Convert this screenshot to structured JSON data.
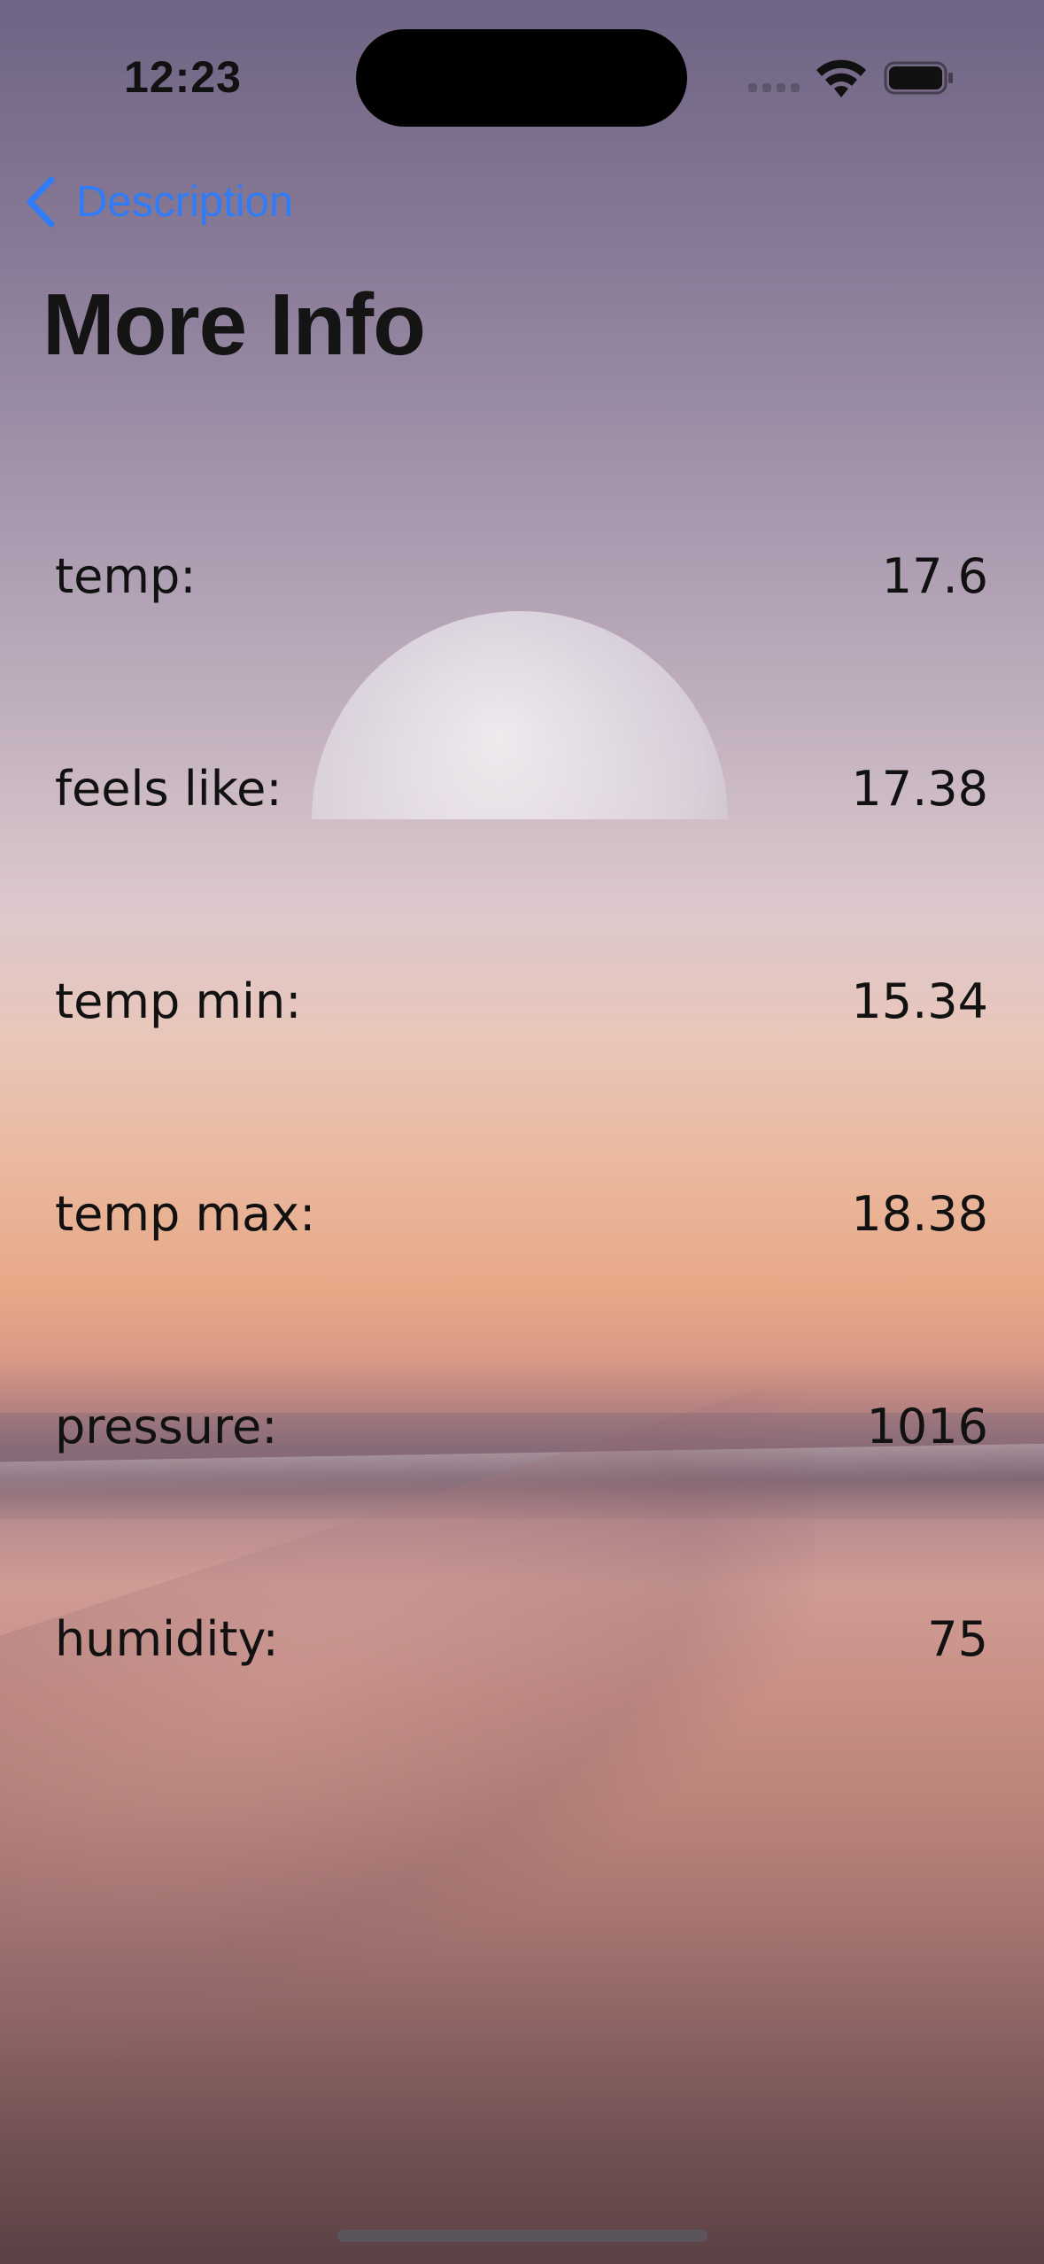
{
  "status_bar": {
    "time": "12:23"
  },
  "nav": {
    "back_label": "Description",
    "title": "More Info"
  },
  "info_rows": [
    {
      "label": "temp:",
      "value": "17.6"
    },
    {
      "label": "feels like:",
      "value": "17.38"
    },
    {
      "label": "temp min:",
      "value": "15.34"
    },
    {
      "label": "temp max:",
      "value": "18.38"
    },
    {
      "label": "pressure:",
      "value": "1016"
    },
    {
      "label": "humidity:",
      "value": "75"
    }
  ],
  "colors": {
    "accent": "#2f7cf6",
    "text": "#111111"
  },
  "icons": {
    "back": "chevron-left-icon",
    "wifi": "wifi-icon",
    "battery": "battery-icon",
    "signal": "cellular-signal-icon"
  }
}
